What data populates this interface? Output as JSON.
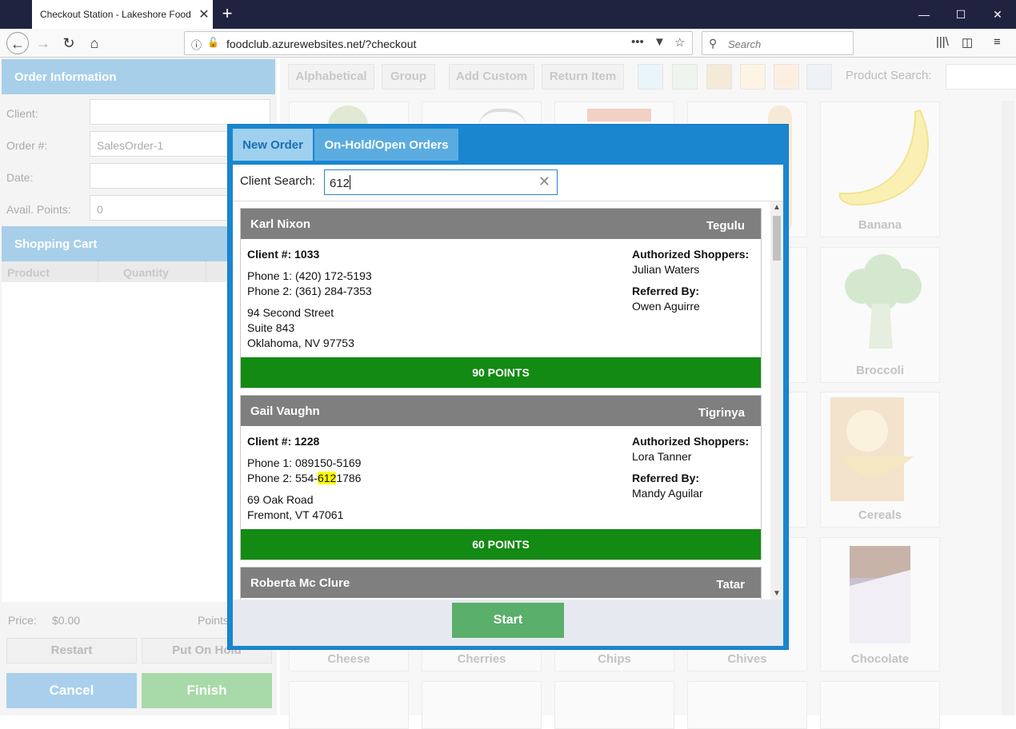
{
  "browser": {
    "tab_title": "Checkout Station - Lakeshore Food",
    "url": "foodclub.azurewebsites.net/?checkout",
    "search_placeholder": "Search"
  },
  "order_info": {
    "header": "Order Information",
    "fields": [
      {
        "label": "Client:",
        "value": ""
      },
      {
        "label": "Order #:",
        "value": "SalesOrder-1"
      },
      {
        "label": "Date:",
        "value": ""
      },
      {
        "label": "Avail. Points:",
        "value": "0"
      }
    ]
  },
  "shopping_cart": {
    "header": "Shopping Cart",
    "columns": [
      "Product",
      "Quantity"
    ],
    "price_label": "Price:",
    "price_value": "$0.00",
    "points_label": "Points"
  },
  "buttons": {
    "restart": "Restart",
    "put_on_hold": "Put On Hold",
    "cancel": "Cancel",
    "finish": "Finish"
  },
  "toolbar": {
    "buttons": [
      "Alphabetical",
      "Group",
      "Add Custom",
      "Return Item"
    ],
    "swatches": [
      "#eaf4fb",
      "#eef5ee",
      "#f3ead8",
      "#fdf4e3",
      "#fcefe2",
      "#eef2f7"
    ],
    "product_search_label": "Product Search:"
  },
  "products": [
    {
      "name": "",
      "icon": "lettuce-icon"
    },
    {
      "name": "",
      "icon": "pepper-icon"
    },
    {
      "name": "",
      "icon": "bacon-icon"
    },
    {
      "name": "",
      "icon": "bread-icon"
    },
    {
      "name": "Banana",
      "icon": "banana-icon"
    },
    {
      "name": "Broccoli",
      "icon": "broccoli-icon"
    },
    {
      "name": "Cereals",
      "icon": "cereal-icon"
    },
    {
      "name": "Cheese",
      "icon": "cheese-icon"
    },
    {
      "name": "Cherries",
      "icon": "cherries-icon"
    },
    {
      "name": "Chips",
      "icon": "chips-icon"
    },
    {
      "name": "Chives",
      "icon": "chives-icon"
    },
    {
      "name": "Chocolate",
      "icon": "chocolate-icon"
    }
  ],
  "modal": {
    "tabs": [
      "New Order",
      "On-Hold/Open Orders"
    ],
    "search_label": "Client Search:",
    "search_value": "612",
    "start_label": "Start",
    "clients": [
      {
        "name": "Karl Nixon",
        "language": "Tegulu",
        "client_label": "Client #:",
        "client_no": "1033",
        "phone1": "Phone 1: (420) 172-5193",
        "phone2_pre": "Phone 2: (361) 284-7353",
        "phone2_hl": "",
        "phone2_post": "",
        "addr1": "94 Second Street",
        "addr2": "Suite 843",
        "addr3": "Oklahoma, NV 97753",
        "auth_label": "Authorized Shoppers:",
        "auth": "Julian Waters",
        "ref_label": "Referred By:",
        "ref": "Owen Aguirre",
        "points": "90 POINTS"
      },
      {
        "name": "Gail Vaughn",
        "language": "Tigrinya",
        "client_label": "Client #:",
        "client_no": "1228",
        "phone1": "Phone 1: 089150-5169",
        "phone2_pre": "Phone 2: 554-",
        "phone2_hl": "612",
        "phone2_post": "1786",
        "addr1": "69 Oak Road",
        "addr2": "Fremont, VT 47061",
        "addr3": "",
        "auth_label": "Authorized Shoppers:",
        "auth": "Lora Tanner",
        "ref_label": "Referred By:",
        "ref": "Mandy Aguilar",
        "points": "60 POINTS"
      },
      {
        "name": "Roberta Mc Clure",
        "language": "Tatar"
      }
    ]
  },
  "colors": {
    "accent": "#1a86d0",
    "points_green": "#138a13",
    "header_gray": "#7f7f7f",
    "highlight": "#ffff00"
  }
}
